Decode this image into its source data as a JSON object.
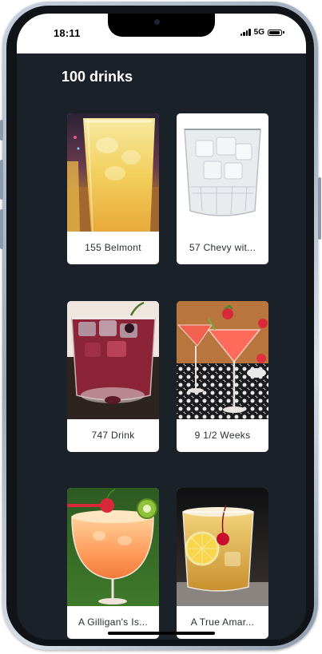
{
  "status_bar": {
    "time": "18:11",
    "network": "5G",
    "battery_level": 0.9
  },
  "page": {
    "title": "100 drinks"
  },
  "drinks": [
    {
      "name": "155 Belmont",
      "image_icon": "yellow-highball-drink-photo"
    },
    {
      "name": "57 Chevy wit...",
      "image_icon": "clear-ice-glass-photo"
    },
    {
      "name": "747 Drink",
      "image_icon": "red-rocks-glass-photo"
    },
    {
      "name": "9 1/2 Weeks",
      "image_icon": "pink-martini-glasses-photo"
    },
    {
      "name": "A Gilligan's Is...",
      "image_icon": "orange-tropical-goblet-photo"
    },
    {
      "name": "A True Amar...",
      "image_icon": "amber-lemon-rocks-photo"
    }
  ],
  "colors": {
    "background": "#1b2128",
    "card": "#ffffff",
    "title": "#ffffff"
  }
}
